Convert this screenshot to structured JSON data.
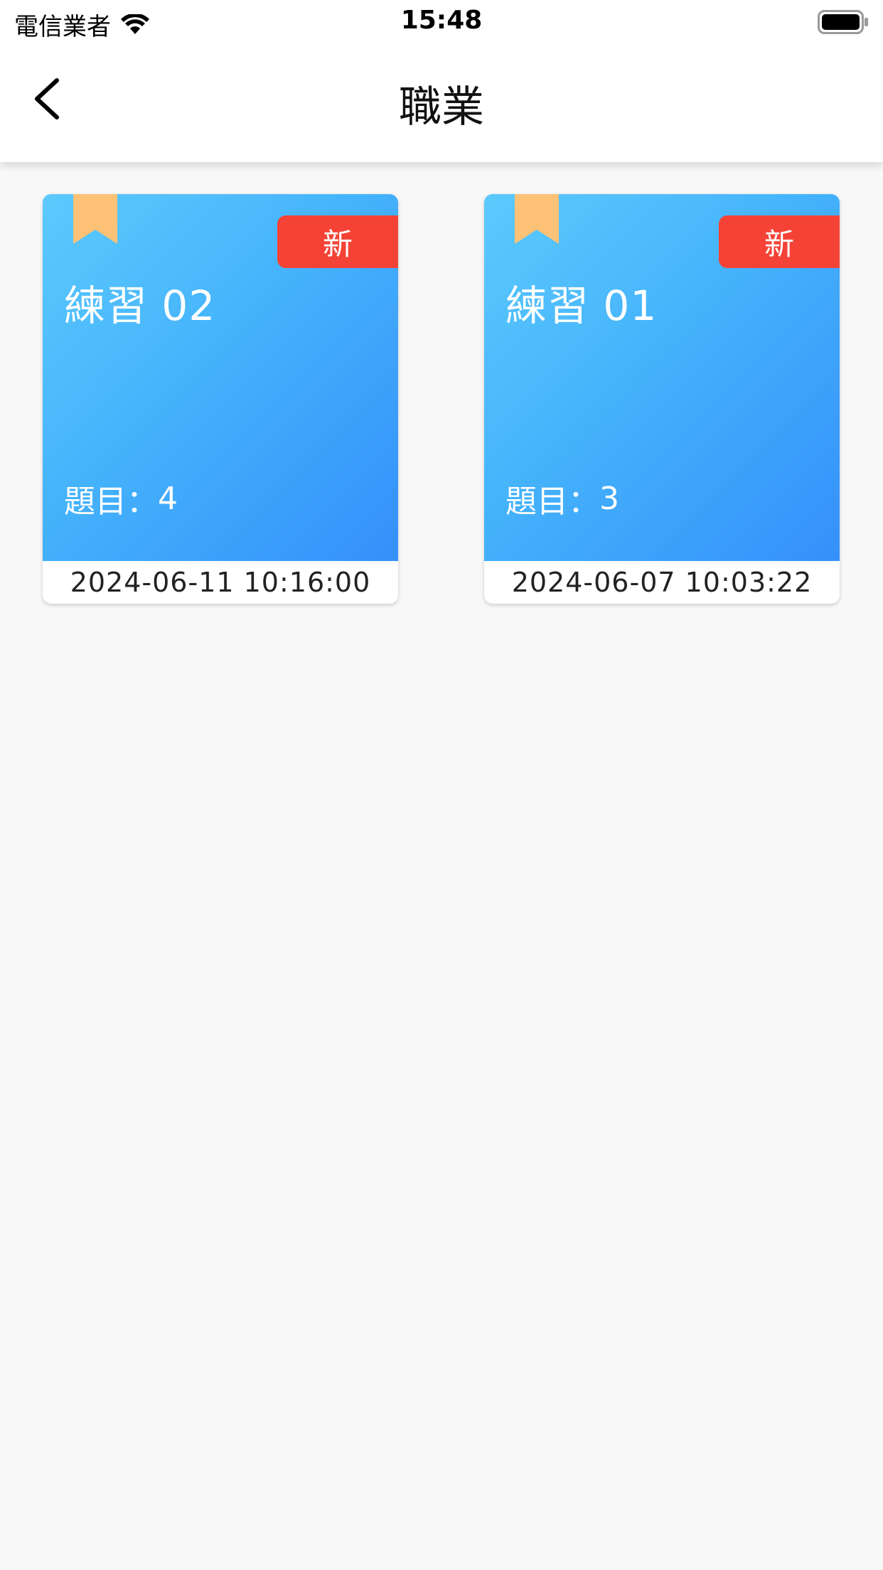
{
  "status_bar": {
    "carrier": "電信業者",
    "time": "15:48",
    "wifi_icon": "wifi-icon",
    "battery_icon": "battery-icon"
  },
  "nav": {
    "title": "職業",
    "back_icon": "chevron-left-icon"
  },
  "cards": [
    {
      "title": "練習 02",
      "badge": "新",
      "question_label": "題目：",
      "question_count": "4",
      "date": "2024-06-11 10:16:00",
      "bookmark_icon": "bookmark-icon"
    },
    {
      "title": "練習 01",
      "badge": "新",
      "question_label": "題目：",
      "question_count": "3",
      "date": "2024-06-07 10:03:22",
      "bookmark_icon": "bookmark-icon"
    }
  ],
  "colors": {
    "card_gradient_start": "#5ccafc",
    "card_gradient_end": "#3590fb",
    "badge": "#f44336",
    "bookmark": "#fdc276",
    "background": "#f8f8f8"
  }
}
